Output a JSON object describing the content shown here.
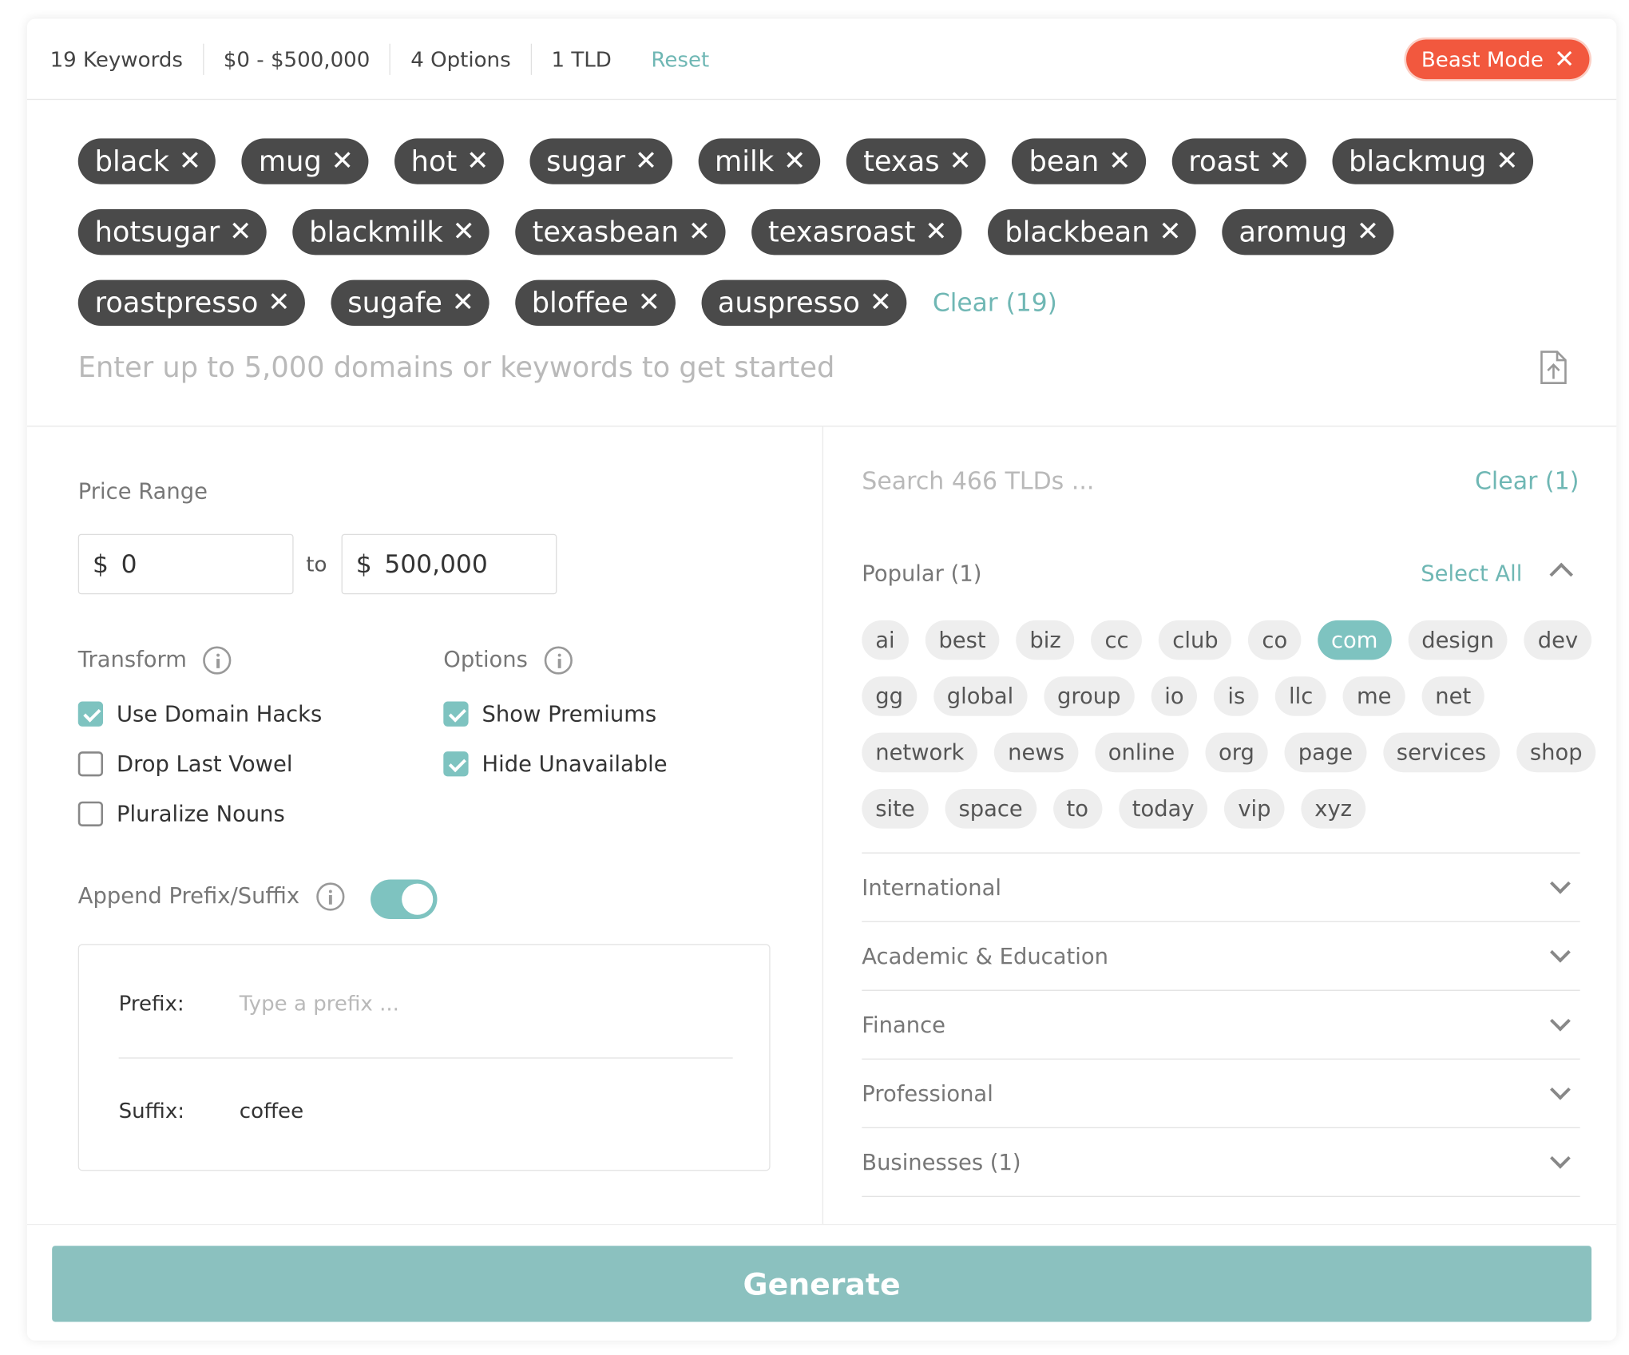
{
  "summary": {
    "keywords": "19 Keywords",
    "price": "$0 - $500,000",
    "options": "4 Options",
    "tlds": "1 TLD",
    "reset": "Reset"
  },
  "beast_mode": {
    "label": "Beast Mode",
    "close": "✕",
    "color": "#f2583e"
  },
  "keyword_tags": {
    "rows": [
      [
        "black",
        "mug",
        "hot",
        "sugar",
        "milk",
        "texas",
        "bean",
        "roast",
        "blackmug"
      ],
      [
        "hotsugar",
        "blackmilk",
        "texasbean",
        "texasroast",
        "blackbean",
        "aromug"
      ],
      [
        "roastpresso",
        "sugafe",
        "bloffee",
        "auspresso"
      ]
    ],
    "remove_glyph": "✕",
    "clear_label": "Clear (19)",
    "input_placeholder": "Enter up to 5,000 domains or keywords to get started",
    "upload_icon": "file-upload-icon"
  },
  "price_range": {
    "label": "Price Range",
    "currency": "$",
    "min": "0",
    "to": "to",
    "max": "500,000"
  },
  "transform": {
    "label": "Transform",
    "items": [
      {
        "label": "Use Domain Hacks",
        "checked": true
      },
      {
        "label": "Drop Last Vowel",
        "checked": false
      },
      {
        "label": "Pluralize Nouns",
        "checked": false
      }
    ]
  },
  "options": {
    "label": "Options",
    "items": [
      {
        "label": "Show Premiums",
        "checked": true
      },
      {
        "label": "Hide Unavailable",
        "checked": true
      }
    ]
  },
  "affix": {
    "label": "Append Prefix/Suffix",
    "enabled": true,
    "prefix_label": "Prefix:",
    "prefix_placeholder": "Type a prefix ...",
    "suffix_label": "Suffix:",
    "suffix_value": "coffee"
  },
  "tld_panel": {
    "search_placeholder": "Search 466 TLDs ...",
    "clear_label": "Clear (1)",
    "popular_label": "Popular (1)",
    "select_all": "Select All",
    "chip_rows": [
      [
        "ai",
        "best",
        "biz",
        "cc",
        "club",
        "co",
        "com",
        "design",
        "dev"
      ],
      [
        "gg",
        "global",
        "group",
        "io",
        "is",
        "llc",
        "me",
        "net"
      ],
      [
        "network",
        "news",
        "online",
        "org",
        "page",
        "services",
        "shop"
      ],
      [
        "site",
        "space",
        "to",
        "today",
        "vip",
        "xyz"
      ]
    ],
    "selected": [
      "com"
    ],
    "categories": [
      "International",
      "Academic & Education",
      "Finance",
      "Professional",
      "Businesses (1)"
    ],
    "accent_color": "#7ec3c0"
  },
  "generate": {
    "label": "Generate",
    "color": "#8bc1bf"
  }
}
